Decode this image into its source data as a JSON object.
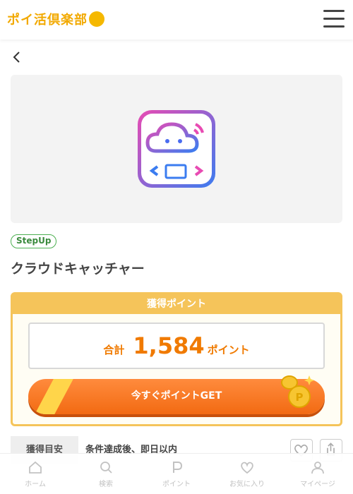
{
  "header": {
    "logo_text": "ポイ活倶楽部",
    "logo_icon": "bee-icon",
    "menu_icon": "hamburger-menu-icon"
  },
  "nav": {
    "back_icon": "chevron-left-icon"
  },
  "offer": {
    "banner_icon": "cloud-catcher-app-icon",
    "tag": "StepUp",
    "title": "クラウドキャッチャー"
  },
  "points": {
    "heading": "獲得ポイント",
    "total_label": "合計",
    "total_value": "1,584",
    "total_unit": "ポイント",
    "get_button": "今すぐポイントGET",
    "coin_icon": "coins-icon"
  },
  "timing": {
    "label": "獲得目安",
    "value": "条件達成後、即日以内"
  },
  "actions": {
    "favorite_icon": "heart-icon",
    "share_icon": "share-icon"
  },
  "bottom_nav": [
    {
      "label": "ホーム",
      "icon": "home-icon"
    },
    {
      "label": "検索",
      "icon": "search-icon"
    },
    {
      "label": "ポイント",
      "icon": "point-p-icon"
    },
    {
      "label": "お気に入り",
      "icon": "heart-icon"
    },
    {
      "label": "マイページ",
      "icon": "user-icon"
    }
  ],
  "colors": {
    "accent_orange": "#f26a12",
    "points_yellow": "#f5c45a",
    "tag_green": "#4caf50",
    "logo_yellow": "#f2a900"
  }
}
